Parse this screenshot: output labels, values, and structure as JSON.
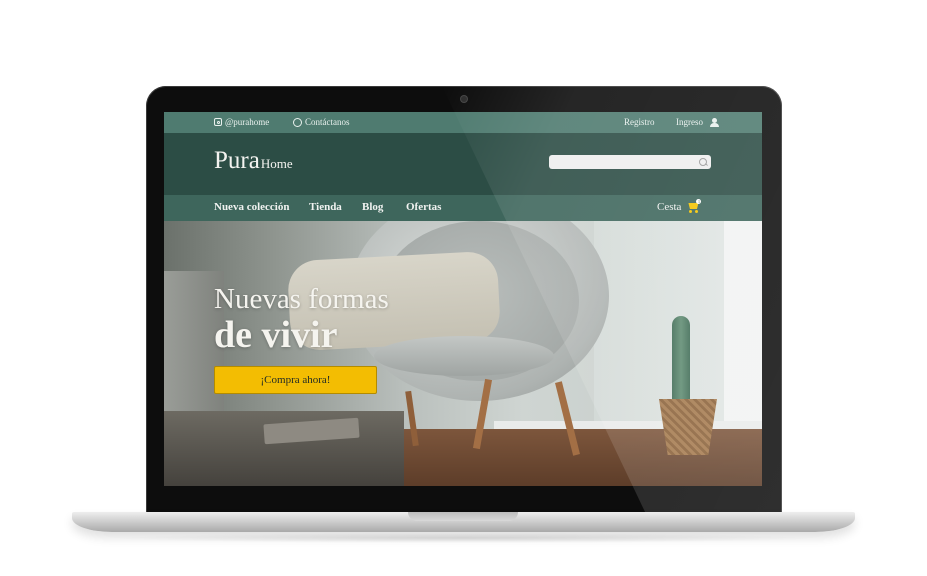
{
  "topbar": {
    "instagram": "@purahome",
    "whatsapp": "Contáctanos",
    "register": "Registro",
    "login": "Ingreso"
  },
  "header": {
    "brand_main": "Pura",
    "brand_sub": "Home",
    "search_value": ""
  },
  "nav": {
    "items": [
      "Nueva colección",
      "Tienda",
      "Blog",
      "Ofertas"
    ],
    "cart_label": "Cesta",
    "cart_count": "1"
  },
  "hero": {
    "line1": "Nuevas formas",
    "line2": "de vivir",
    "cta": "¡Compra ahora!"
  },
  "colors": {
    "topbar": "#4f7b70",
    "header": "#2c4d45",
    "navbar": "#3e665c",
    "cta": "#f3bd02"
  }
}
